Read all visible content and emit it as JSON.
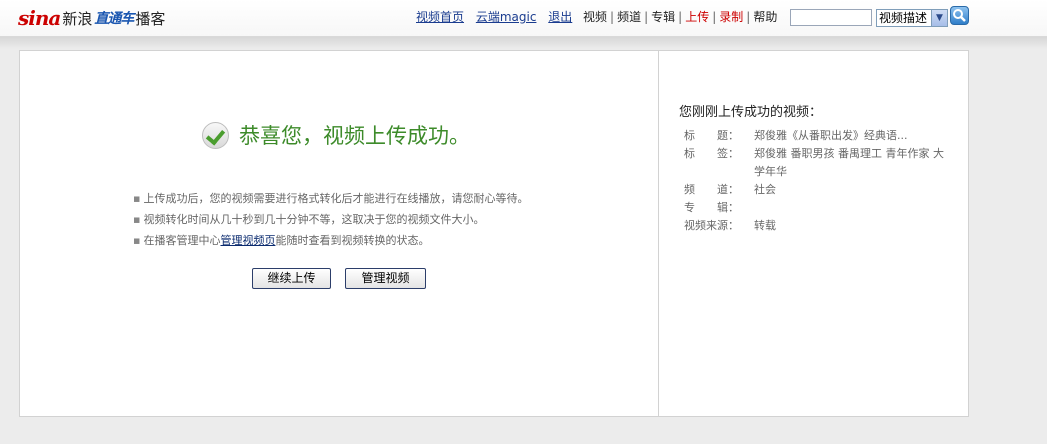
{
  "header": {
    "logo": {
      "sina": "sina",
      "cn": "新浪",
      "brand": "直通车",
      "suffix": "播客"
    },
    "links": [
      "视频首页",
      "云端magic",
      "退出"
    ],
    "nav": [
      {
        "label": "视频",
        "highlight": false
      },
      {
        "label": "频道",
        "highlight": false
      },
      {
        "label": "专辑",
        "highlight": false
      },
      {
        "label": "上传",
        "highlight": true
      },
      {
        "label": "录制",
        "highlight": true
      },
      {
        "label": "帮助",
        "highlight": false
      }
    ],
    "search": {
      "value": "",
      "select_value": "视频描述"
    }
  },
  "main": {
    "success_text": "恭喜您，视频上传成功。",
    "tips": {
      "t1": "上传成功后，您的视频需要进行格式转化后才能进行在线播放，请您耐心等待。",
      "t2": "视频转化时间从几十秒到几十分钟不等，这取决于您的视频文件大小。",
      "t3_pre": "在播客管理中心",
      "t3_link": "管理视频页",
      "t3_post": "能随时查看到视频转换的状态。"
    },
    "buttons": {
      "continue": "继续上传",
      "manage": "管理视频"
    }
  },
  "side": {
    "title": "您刚刚上传成功的视频：",
    "fields": [
      {
        "label": "标　　题：",
        "value": "郑俊雅《从番职出发》经典语..."
      },
      {
        "label": "标　　签：",
        "value": "郑俊雅 番职男孩 番禺理工 青年作家 大学年华"
      },
      {
        "label": "频　　道：",
        "value": "社会"
      },
      {
        "label": "专　　辑：",
        "value": ""
      },
      {
        "label": "视频来源：",
        "value": "转载"
      }
    ]
  },
  "colors": {
    "accent_green": "#3d8b2a",
    "link_blue": "#1a3c8f",
    "nav_red": "#c00000"
  }
}
